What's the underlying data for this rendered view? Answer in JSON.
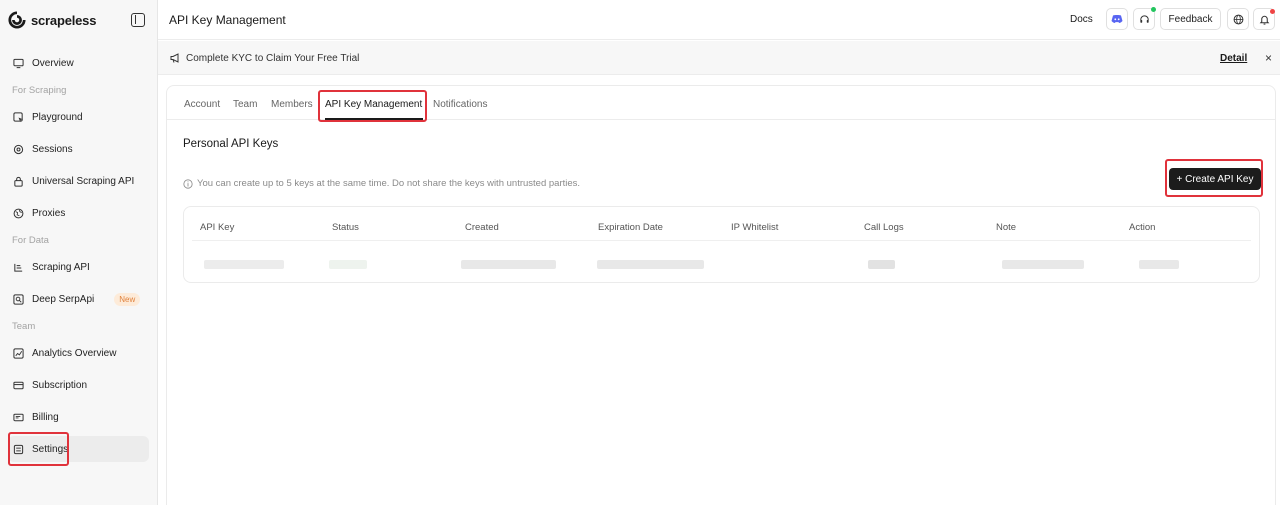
{
  "brand": {
    "name": "scrapeless"
  },
  "sidebar": {
    "items": [
      {
        "label": "Overview",
        "icon": "monitor-icon"
      },
      {
        "label": "Playground",
        "icon": "playground-icon"
      },
      {
        "label": "Sessions",
        "icon": "sessions-icon"
      },
      {
        "label": "Universal Scraping API",
        "icon": "lock-icon"
      },
      {
        "label": "Proxies",
        "icon": "globe-icon"
      },
      {
        "label": "Scraping API",
        "icon": "scraping-icon"
      },
      {
        "label": "Deep SerpApi",
        "icon": "search-icon",
        "badge": "New"
      },
      {
        "label": "Analytics Overview",
        "icon": "chart-icon"
      },
      {
        "label": "Subscription",
        "icon": "card-icon"
      },
      {
        "label": "Billing",
        "icon": "billing-icon"
      },
      {
        "label": "Settings",
        "icon": "settings-icon"
      }
    ],
    "sections": [
      "For Scraping",
      "For Data",
      "Team"
    ]
  },
  "header": {
    "title": "API Key Management",
    "docs": "Docs",
    "feedback": "Feedback"
  },
  "banner": {
    "text": "Complete KYC to Claim Your Free Trial",
    "detail": "Detail",
    "close": "×"
  },
  "tabs": [
    "Account",
    "Team",
    "Members",
    "API Key Management",
    "Notifications"
  ],
  "main": {
    "section_title": "Personal API Keys",
    "info": "You can create up to 5 keys at the same time. Do not share the keys with untrusted parties.",
    "create_button": "+ Create API Key"
  },
  "table": {
    "columns": [
      "API Key",
      "Status",
      "Created",
      "Expiration Date",
      "IP Whitelist",
      "Call Logs",
      "Note",
      "Action"
    ]
  },
  "colors": {
    "highlight": "#e0323b",
    "primary_button": "#1c1c1c",
    "badge_bg": "#fdebd9",
    "badge_text": "#e0823d",
    "discord": "#5865f2",
    "status_green": "#22c55e",
    "notification_red": "#ef4444"
  }
}
